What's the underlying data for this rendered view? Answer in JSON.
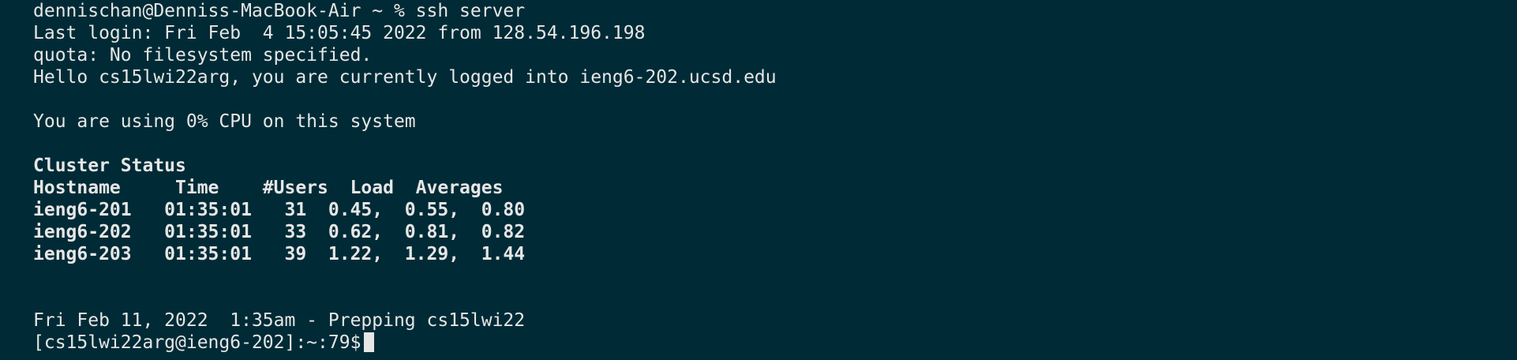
{
  "terminal": {
    "lines": [
      {
        "text": "dennischan@Denniss-MacBook-Air ~ % ssh server",
        "bold": false
      },
      {
        "text": "Last login: Fri Feb  4 15:05:45 2022 from 128.54.196.198",
        "bold": false
      },
      {
        "text": "quota: No filesystem specified.",
        "bold": false
      },
      {
        "text": "Hello cs15lwi22arg, you are currently logged into ieng6-202.ucsd.edu",
        "bold": false
      },
      {
        "text": "",
        "bold": false
      },
      {
        "text": "You are using 0% CPU on this system",
        "bold": false
      },
      {
        "text": "",
        "bold": false
      },
      {
        "text": "Cluster Status",
        "bold": true
      },
      {
        "text": "Hostname     Time    #Users  Load  Averages",
        "bold": true
      },
      {
        "text": "ieng6-201   01:35:01   31  0.45,  0.55,  0.80",
        "bold": true
      },
      {
        "text": "ieng6-202   01:35:01   33  0.62,  0.81,  0.82",
        "bold": true
      },
      {
        "text": "ieng6-203   01:35:01   39  1.22,  1.29,  1.44",
        "bold": true
      },
      {
        "text": "",
        "bold": false
      },
      {
        "text": "",
        "bold": false
      },
      {
        "text": "Fri Feb 11, 2022  1:35am - Prepping cs15lwi22",
        "bold": false
      }
    ],
    "prompt": "[cs15lwi22arg@ieng6-202]:~:79$"
  }
}
